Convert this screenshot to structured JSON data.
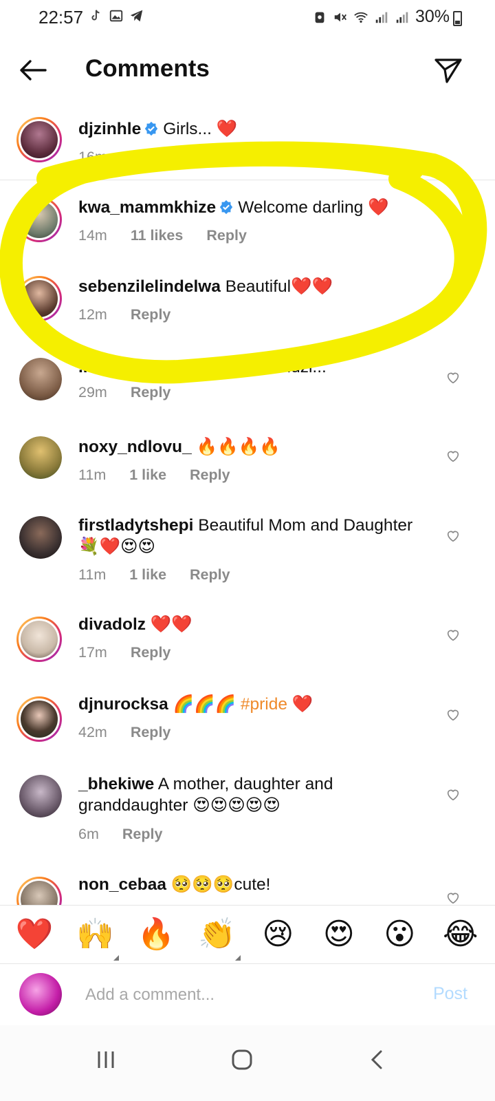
{
  "status_bar": {
    "time": "22:57",
    "battery": "30%"
  },
  "header": {
    "title": "Comments"
  },
  "caption": {
    "username": "djzinhle",
    "text": "Girls... ❤️",
    "meta": "16m · Edited",
    "avatar_color": "#5a2a3a"
  },
  "comments": [
    {
      "username": "kwa_mammkhize",
      "verified": true,
      "text": "Welcome darling ❤️",
      "time": "14m",
      "likes": "11 likes",
      "reply": "Reply",
      "avatar_color": "#6d7a6a"
    },
    {
      "username": "sebenzilelindelwa",
      "verified": false,
      "text": "Beautiful❤️❤️",
      "time": "12m",
      "likes": "",
      "reply": "Reply",
      "avatar_color": "#5a3b2e"
    },
    {
      "username": "...rau_mukwevho",
      "verified": false,
      "text": "Mia vhasidzi...",
      "time": "29m",
      "likes": "",
      "reply": "Reply",
      "avatar_color": "#7a5a44"
    },
    {
      "username": "noxy_ndlovu_",
      "verified": false,
      "text": "🔥🔥🔥🔥",
      "time": "11m",
      "likes": "1 like",
      "reply": "Reply",
      "avatar_color": "#8a7a3a"
    },
    {
      "username": "firstladytshepi",
      "verified": false,
      "text": "Beautiful Mom and Daughter 💐❤️😍😍",
      "time": "11m",
      "likes": "1 like",
      "reply": "Reply",
      "avatar_color": "#3a3030"
    },
    {
      "username": "divadolz",
      "verified": false,
      "text": "❤️❤️",
      "time": "17m",
      "likes": "",
      "reply": "Reply",
      "avatar_color": "#c9b9a8"
    },
    {
      "username": "djnurocksa",
      "verified": false,
      "text": "🌈🌈🌈",
      "tag": "#pride",
      "text_after": "❤️",
      "time": "42m",
      "likes": "",
      "reply": "Reply",
      "avatar_color": "#4a3a2e"
    },
    {
      "username": "_bhekiwe",
      "verified": false,
      "text": "A mother, daughter  and granddaughter 😍😍😍😍😍",
      "time": "6m",
      "likes": "",
      "reply": "Reply",
      "avatar_color": "#6a5a6a"
    },
    {
      "username": "non_cebaa",
      "verified": false,
      "text": "🥺🥺🥺cute!",
      "time": "",
      "likes": "",
      "reply": "",
      "avatar_color": "#8a7a6a"
    }
  ],
  "emoji_bar": [
    "❤️",
    "🙌",
    "🔥",
    "👏",
    "😢",
    "😍",
    "😮",
    "😂"
  ],
  "composer": {
    "placeholder": "Add a comment...",
    "post_label": "Post"
  },
  "colors": {
    "highlight": "#f5ef00",
    "verified": "#3897f0",
    "post_disabled": "#b3dbff"
  }
}
